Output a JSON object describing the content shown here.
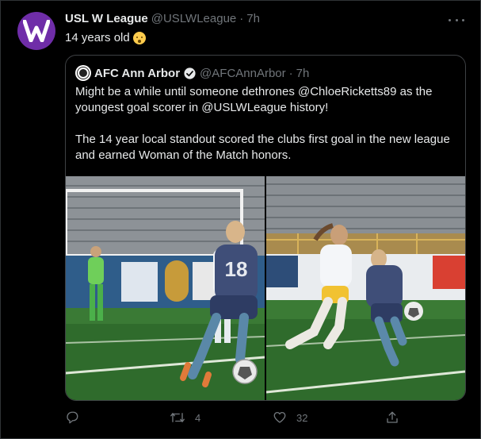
{
  "tweet": {
    "author_name": "USL W League",
    "author_handle": "@USLWLeague",
    "separator": "·",
    "time": "7h",
    "text": "14 years old",
    "avatar_icon": "usl-w-league-logo",
    "avatar_color": "#6f2da8"
  },
  "quoted": {
    "author_name": "AFC Ann Arbor",
    "author_handle": "@AFCAnnArbor",
    "separator": "·",
    "time": "7h",
    "verified_icon": "verified-badge-icon",
    "paragraph1": "Might be a while until someone dethrones @ChloeRicketts89 as the youngest goal scorer in @USLWLeague history!",
    "paragraph2": "The 14 year local standout scored the clubs first goal in the new league and earned Woman of the Match honors.",
    "photos": [
      {
        "icon": "soccer-photo-player-18"
      },
      {
        "icon": "soccer-photo-dribble"
      }
    ]
  },
  "actions": {
    "reply_count": "",
    "retweet_count": "4",
    "like_count": "32",
    "share_count": ""
  },
  "colors": {
    "background": "#000000",
    "text": "#e7e9ea",
    "muted": "#71767b",
    "border": "#2f3336"
  }
}
